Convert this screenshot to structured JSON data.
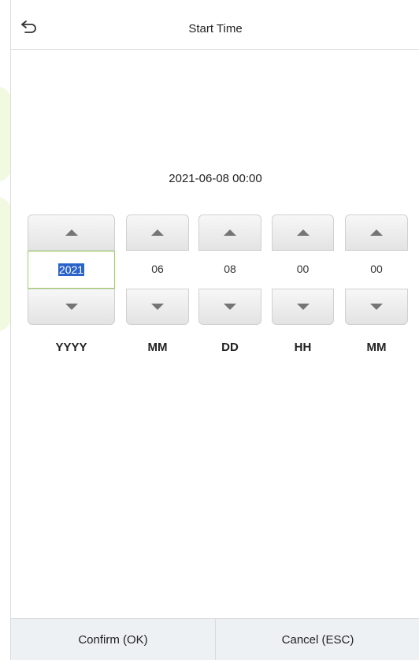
{
  "header": {
    "title": "Start Time",
    "back_icon": "back-arrow-icon"
  },
  "datetime_display": "2021-06-08 00:00",
  "pickers": [
    {
      "id": "year",
      "value": "2021",
      "unit": "YYYY",
      "selected": true
    },
    {
      "id": "month",
      "value": "06",
      "unit": "MM",
      "selected": false
    },
    {
      "id": "day",
      "value": "08",
      "unit": "DD",
      "selected": false
    },
    {
      "id": "hour",
      "value": "00",
      "unit": "HH",
      "selected": false
    },
    {
      "id": "minute",
      "value": "00",
      "unit": "MM",
      "selected": false
    }
  ],
  "footer": {
    "confirm_label": "Confirm (OK)",
    "cancel_label": "Cancel (ESC)"
  },
  "colors": {
    "selection_bg": "#2a63c9",
    "active_border": "#9ccf62",
    "footer_bg": "#eef1f4"
  }
}
